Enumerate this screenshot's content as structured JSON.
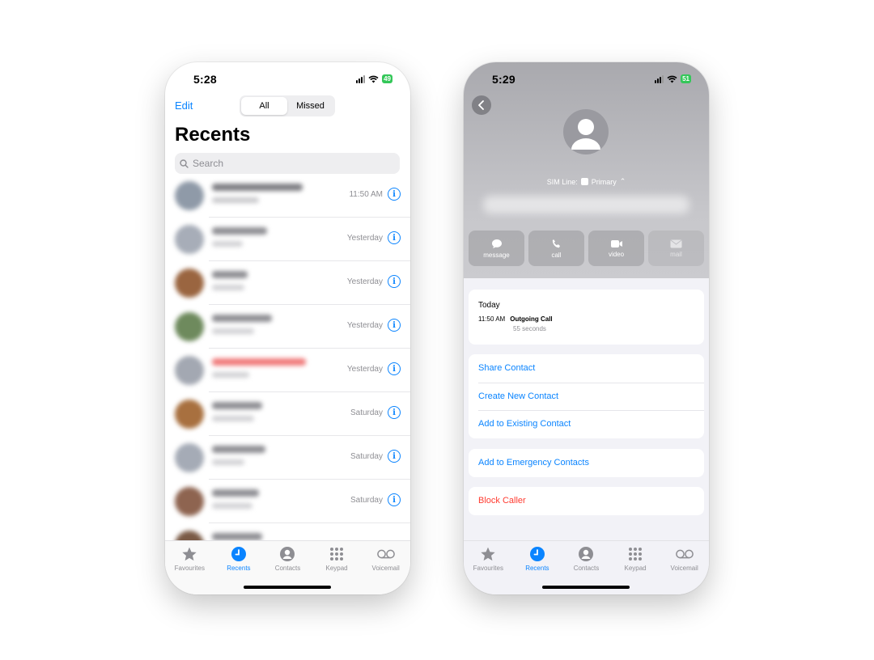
{
  "left": {
    "status": {
      "time": "5:28",
      "battery": "49"
    },
    "nav": {
      "edit": "Edit",
      "segments": [
        "All",
        "Missed"
      ],
      "active_segment": "All"
    },
    "title": "Recents",
    "search": {
      "placeholder": "Search"
    },
    "calls": [
      {
        "time": "11:50 AM",
        "missed": false
      },
      {
        "time": "Yesterday",
        "missed": false
      },
      {
        "time": "Yesterday",
        "missed": false
      },
      {
        "time": "Yesterday",
        "missed": false
      },
      {
        "time": "Yesterday",
        "missed": true
      },
      {
        "time": "Saturday",
        "missed": false
      },
      {
        "time": "Saturday",
        "missed": false
      },
      {
        "time": "Saturday",
        "missed": false
      }
    ]
  },
  "right": {
    "status": {
      "time": "5:29",
      "battery": "51"
    },
    "sim": {
      "label": "SIM Line:",
      "value": "Primary"
    },
    "actions": [
      "message",
      "call",
      "video",
      "mail"
    ],
    "history": {
      "day": "Today",
      "time": "11:50 AM",
      "type": "Outgoing Call",
      "duration": "55 seconds"
    },
    "menu": {
      "share": "Share Contact",
      "create": "Create New Contact",
      "add_existing": "Add to Existing Contact",
      "emergency": "Add to Emergency Contacts",
      "block": "Block Caller"
    }
  },
  "tabs": [
    "Favourites",
    "Recents",
    "Contacts",
    "Keypad",
    "Voicemail"
  ],
  "active_tab": "Recents",
  "colors": {
    "accent": "#0a84ff",
    "destructive": "#ff3b30",
    "battery": "#34c759"
  }
}
